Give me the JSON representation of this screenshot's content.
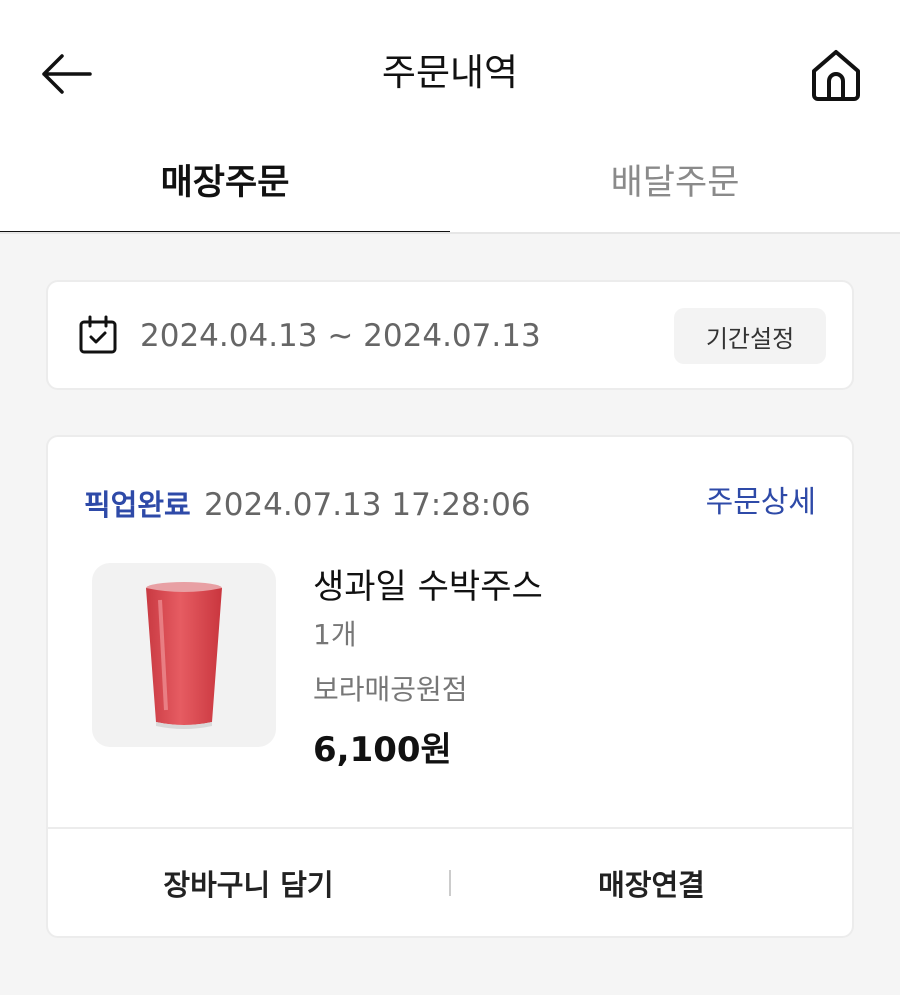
{
  "header": {
    "title": "주문내역",
    "back_icon": "arrow-left-icon",
    "home_icon": "home-icon"
  },
  "tabs": [
    {
      "label": "매장주문",
      "active": true
    },
    {
      "label": "배달주문",
      "active": false
    }
  ],
  "date_filter": {
    "icon": "calendar-check-icon",
    "range": "2024.04.13 ~ 2024.07.13",
    "button_label": "기간설정"
  },
  "order": {
    "status": "픽업완료",
    "datetime": "2024.07.13 17:28:06",
    "detail_link": "주문상세",
    "product": {
      "name": "생과일 수박주스",
      "quantity": "1개",
      "store": "보라매공원점",
      "price": "6,100원",
      "image": "watermelon-juice-image"
    },
    "actions": {
      "add_to_cart": "장바구니 담기",
      "connect_store": "매장연결"
    }
  },
  "colors": {
    "accent": "#2e4aa8",
    "background": "#f5f5f5",
    "juice": "#e0545a"
  }
}
